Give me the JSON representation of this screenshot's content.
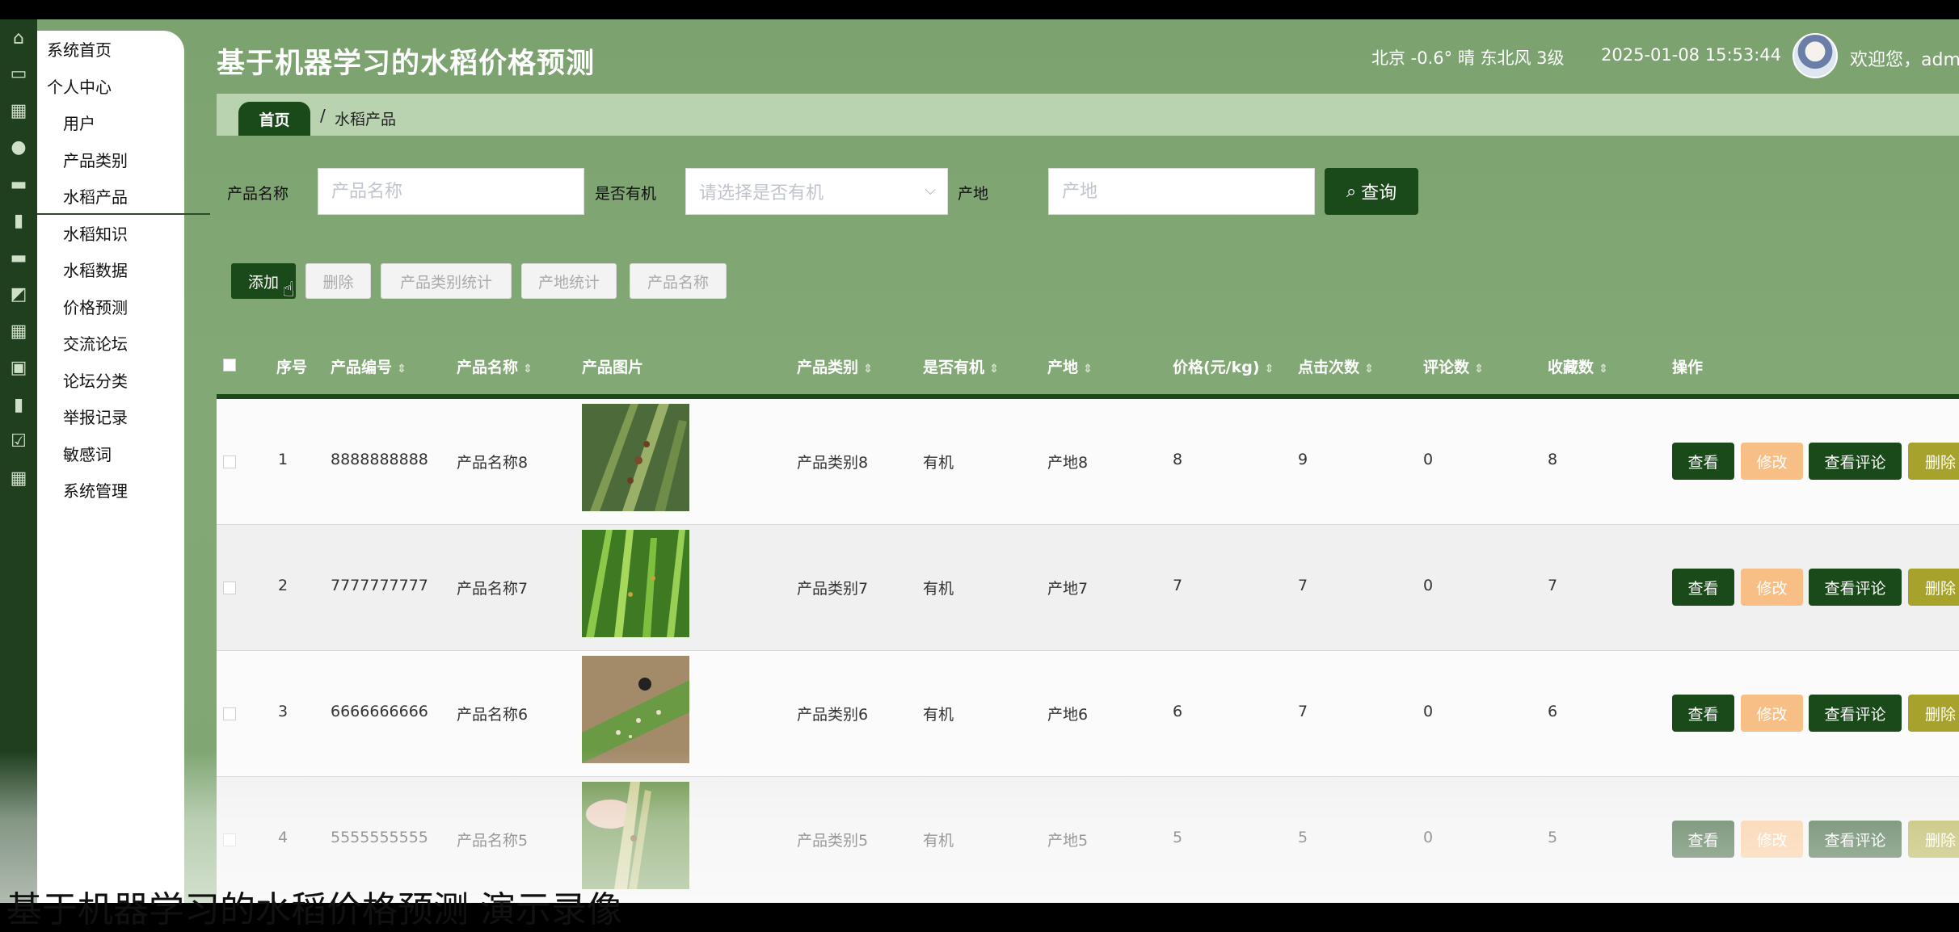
{
  "app": {
    "title": "基于机器学习的水稻价格预测",
    "weather": "北京  -0.6°  晴  东北风  3级",
    "datetime": "2025-01-08 15:53:44",
    "welcome": "欢迎您，admi"
  },
  "sidebar": {
    "items": [
      {
        "label": "系统首页",
        "icon": "home-icon"
      },
      {
        "label": "个人中心",
        "icon": "card-icon"
      },
      {
        "label": "用户",
        "icon": "grid-icon"
      },
      {
        "label": "产品类别",
        "icon": "user-icon"
      },
      {
        "label": "水稻产品",
        "icon": "briefcase-icon",
        "active": true
      },
      {
        "label": "水稻知识",
        "icon": "clipboard-icon"
      },
      {
        "label": "水稻数据",
        "icon": "monitor-icon"
      },
      {
        "label": "价格预测",
        "icon": "chart-icon"
      },
      {
        "label": "交流论坛",
        "icon": "apps-icon"
      },
      {
        "label": "论坛分类",
        "icon": "tag-icon"
      },
      {
        "label": "举报记录",
        "icon": "bar-icon"
      },
      {
        "label": "敏感词",
        "icon": "check-icon"
      },
      {
        "label": "系统管理",
        "icon": "apps-icon"
      }
    ]
  },
  "breadcrumb": {
    "home": "首页",
    "separator": "/",
    "current": "水稻产品"
  },
  "search": {
    "name_label": "产品名称",
    "name_placeholder": "产品名称",
    "organic_label": "是否有机",
    "organic_placeholder": "请选择是否有机",
    "origin_label": "产地",
    "origin_placeholder": "产地",
    "query_label": "查询"
  },
  "actions": {
    "add": "添加",
    "delete": "删除",
    "category_stats": "产品类别统计",
    "origin_stats": "产地统计",
    "name_stats": "产品名称"
  },
  "table": {
    "headers": {
      "index": "序号",
      "code": "产品编号",
      "name": "产品名称",
      "image": "产品图片",
      "category": "产品类别",
      "organic": "是否有机",
      "origin": "产地",
      "price": "价格(元/kg)",
      "clicks": "点击次数",
      "comments": "评论数",
      "favorites": "收藏数",
      "ops": "操作"
    },
    "rows": [
      {
        "index": "1",
        "code": "8888888888",
        "name": "产品名称8",
        "category": "产品类别8",
        "organic": "有机",
        "origin": "产地8",
        "price": "8",
        "clicks": "9",
        "comments": "0",
        "favorites": "8"
      },
      {
        "index": "2",
        "code": "7777777777",
        "name": "产品名称7",
        "category": "产品类别7",
        "organic": "有机",
        "origin": "产地7",
        "price": "7",
        "clicks": "7",
        "comments": "0",
        "favorites": "7"
      },
      {
        "index": "3",
        "code": "6666666666",
        "name": "产品名称6",
        "category": "产品类别6",
        "organic": "有机",
        "origin": "产地6",
        "price": "6",
        "clicks": "7",
        "comments": "0",
        "favorites": "6"
      },
      {
        "index": "4",
        "code": "5555555555",
        "name": "产品名称5",
        "category": "产品类别5",
        "organic": "有机",
        "origin": "产地5",
        "price": "5",
        "clicks": "5",
        "comments": "0",
        "favorites": "5"
      }
    ],
    "row_buttons": {
      "view": "查看",
      "edit": "修改",
      "view_comments": "查看评论",
      "delete": "删除"
    }
  },
  "caption": "基于机器学习的水稻价格预测 演示录像",
  "colors": {
    "primary": "#1a4a1a",
    "background": "#7ba26f",
    "edit": "#f7bf86",
    "delete": "#a6a22c"
  }
}
